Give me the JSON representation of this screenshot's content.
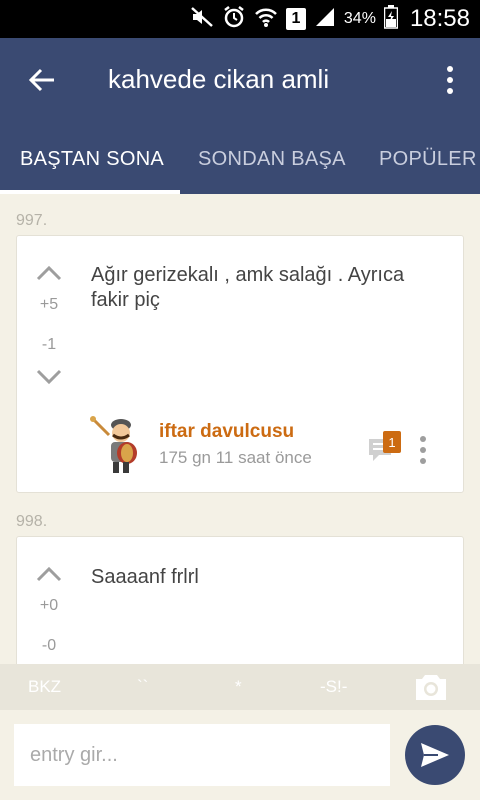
{
  "statusbar": {
    "sim_slot": "1",
    "battery_percent": "34%",
    "time": "18:58"
  },
  "appbar": {
    "title": "kahvede cikan amli",
    "tabs": [
      {
        "label": "BAŞTAN SONA",
        "active": true
      },
      {
        "label": "SONDAN BAŞA",
        "active": false
      },
      {
        "label": "POPÜLER",
        "active": false
      }
    ]
  },
  "entries": [
    {
      "number": "997.",
      "upvotes": "+5",
      "downvotes": "-1",
      "text": "Ağır gerizekalı , amk salağı . Ayrıca fakir piç",
      "author": "iftar davulcusu",
      "time_ago": "175 gn 11 saat  önce",
      "comment_count": "1"
    },
    {
      "number": "998.",
      "upvotes": "+0",
      "downvotes": "-0",
      "text": "Saaaanf frlrl"
    }
  ],
  "helperbar": {
    "items": [
      "BKZ",
      "``",
      "*",
      "-S!-"
    ]
  },
  "composer": {
    "placeholder": "entry gir..."
  },
  "colors": {
    "primary": "#3a4a72",
    "accent": "#cc6b12",
    "background": "#f4f1e6"
  },
  "icons": {
    "back": "arrow-left-icon",
    "menu": "more-vert-icon",
    "upvote": "chevron-up-icon",
    "downvote": "chevron-down-icon",
    "comment": "comment-icon",
    "camera": "camera-icon",
    "send": "send-icon"
  }
}
